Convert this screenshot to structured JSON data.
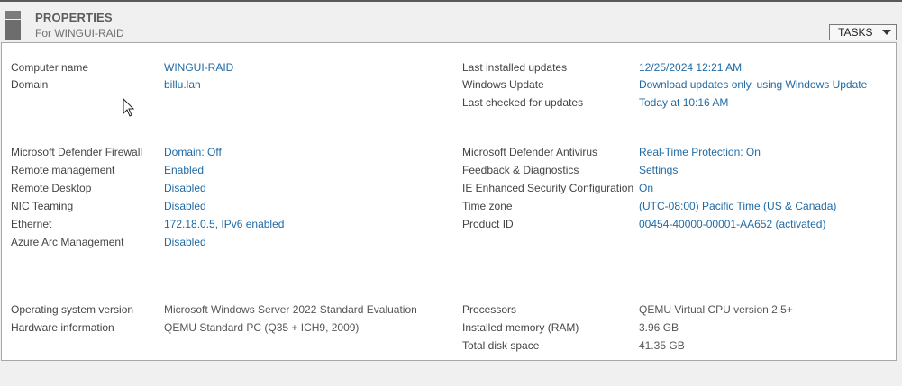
{
  "header": {
    "title": "PROPERTIES",
    "subtitle": "For WINGUI-RAID",
    "tasks_label": "TASKS"
  },
  "left_group1": [
    {
      "label": "Computer name",
      "value": "WINGUI-RAID"
    },
    {
      "label": "Domain",
      "value": "billu.lan"
    }
  ],
  "right_group1": [
    {
      "label": "Last installed updates",
      "value": "12/25/2024 12:21 AM"
    },
    {
      "label": "Windows Update",
      "value": "Download updates only, using Windows Update"
    },
    {
      "label": "Last checked for updates",
      "value": "Today at 10:16 AM"
    }
  ],
  "left_group2": [
    {
      "label": "Microsoft Defender Firewall",
      "value": "Domain: Off"
    },
    {
      "label": "Remote management",
      "value": "Enabled"
    },
    {
      "label": "Remote Desktop",
      "value": "Disabled"
    },
    {
      "label": "NIC Teaming",
      "value": "Disabled"
    },
    {
      "label": "Ethernet",
      "value": "172.18.0.5, IPv6 enabled"
    },
    {
      "label": "Azure Arc Management",
      "value": "Disabled"
    }
  ],
  "right_group2": [
    {
      "label": "Microsoft Defender Antivirus",
      "value": "Real-Time Protection: On"
    },
    {
      "label": "Feedback & Diagnostics",
      "value": "Settings"
    },
    {
      "label": "IE Enhanced Security Configuration",
      "value": "On"
    },
    {
      "label": "Time zone",
      "value": "(UTC-08:00) Pacific Time (US & Canada)"
    },
    {
      "label": "Product ID",
      "value": "00454-40000-00001-AA652 (activated)"
    }
  ],
  "left_group3": [
    {
      "label": "Operating system version",
      "value": "Microsoft Windows Server 2022 Standard Evaluation"
    },
    {
      "label": "Hardware information",
      "value": "QEMU Standard PC (Q35 + ICH9, 2009)"
    }
  ],
  "right_group3": [
    {
      "label": "Processors",
      "value": "QEMU Virtual CPU version 2.5+"
    },
    {
      "label": "Installed memory (RAM)",
      "value": "3.96 GB"
    },
    {
      "label": "Total disk space",
      "value": "41.35 GB"
    }
  ]
}
